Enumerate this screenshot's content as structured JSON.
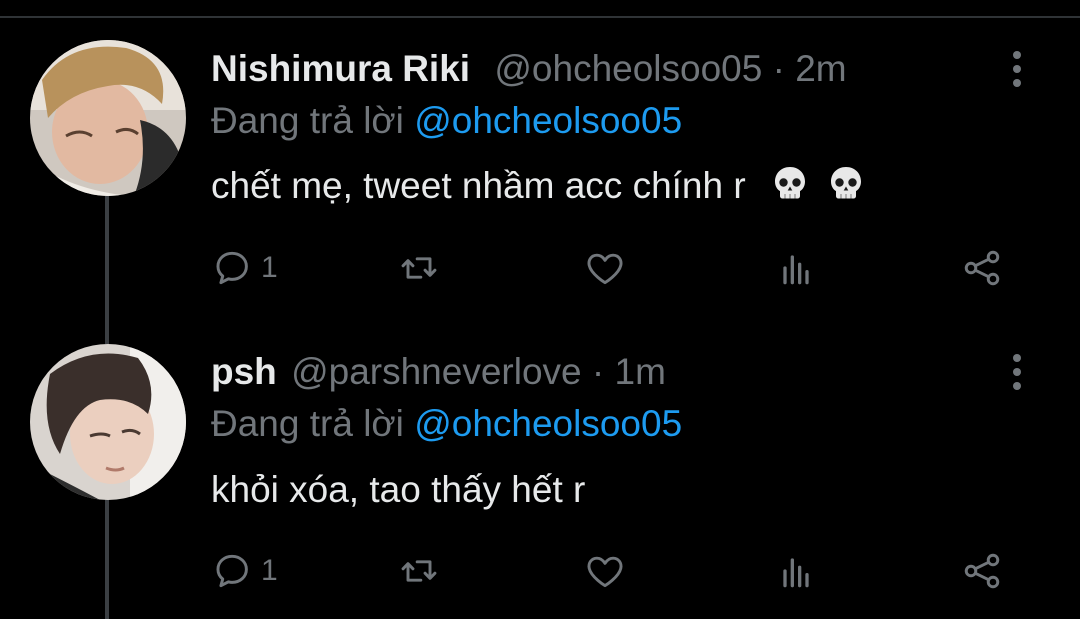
{
  "tweets": [
    {
      "display_name": "Nishimura Riki",
      "handle": "@ohcheolsoo05",
      "separator": "·",
      "time": "2m",
      "replying_prefix": "Đang trả lời",
      "replying_to": "@ohcheolsoo05",
      "text": "chết mẹ, tweet nhầm acc chính r",
      "emojis": [
        "skull-emoji",
        "skull-emoji"
      ],
      "reply_count": "1"
    },
    {
      "display_name": "psh",
      "handle": "@parshneverlove",
      "separator": "·",
      "time": "1m",
      "replying_prefix": "Đang trả lời",
      "replying_to": "@ohcheolsoo05",
      "text": "khỏi xóa, tao thấy hết r",
      "emojis": [],
      "reply_count": "1"
    }
  ],
  "icons": {
    "reply": "reply-icon",
    "retweet": "retweet-icon",
    "like": "heart-icon",
    "analytics": "analytics-icon",
    "share": "share-icon",
    "more": "more-options-icon"
  },
  "colors": {
    "background": "#000000",
    "text": "#e7e9ea",
    "secondary": "#71767b",
    "accent": "#1d9bf0",
    "thread_line": "#3b3f43"
  }
}
